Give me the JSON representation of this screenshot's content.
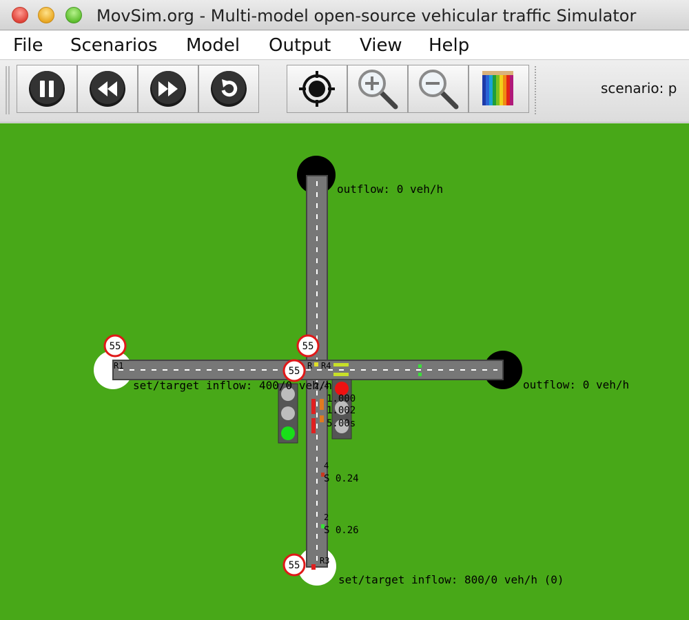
{
  "window": {
    "title": "MovSim.org - Multi-model open-source vehicular traffic Simulator"
  },
  "menu": {
    "items": [
      "File",
      "Scenarios",
      "Model",
      "Output",
      "View",
      "Help"
    ]
  },
  "toolbar": {
    "buttons": [
      {
        "name": "pause",
        "icon": "pause-icon"
      },
      {
        "name": "rewind",
        "icon": "rewind-icon"
      },
      {
        "name": "fast-forward",
        "icon": "fast-forward-icon"
      },
      {
        "name": "restart",
        "icon": "restart-icon"
      },
      {
        "name": "recenter",
        "icon": "crosshair-icon"
      },
      {
        "name": "zoom-in",
        "icon": "zoom-in-icon"
      },
      {
        "name": "zoom-out",
        "icon": "zoom-out-icon"
      },
      {
        "name": "colors",
        "icon": "colored-pencils-icon"
      }
    ],
    "scenario_label": "scenario:  p"
  },
  "simulation": {
    "background_color": "#48a818",
    "road_color": "#777777",
    "labels": {
      "outflow_north": "outflow: 0 veh/h",
      "outflow_east": "outflow: 0 veh/h",
      "inflow_west": "set/target inflow: 400/0 veh/h",
      "inflow_south": "set/target inflow: 800/0 veh/h (0)",
      "road_r1": "R1",
      "road_r3": "R3",
      "road_r4": "R4",
      "road_r": "R",
      "detector_1_count": "4",
      "detector_1_value": "S 0.24",
      "detector_2_count": "2",
      "detector_2_value": "S 0.26",
      "cluster_top": "2.4",
      "cluster_a": "1.000",
      "cluster_b": "1.002",
      "cluster_c": "5.00s"
    },
    "speed_limit_signs": [
      "55",
      "55",
      "55",
      "55"
    ],
    "traffic_lights": [
      {
        "name": "west-signal",
        "state": "green"
      },
      {
        "name": "east-signal",
        "state": "red"
      }
    ]
  }
}
